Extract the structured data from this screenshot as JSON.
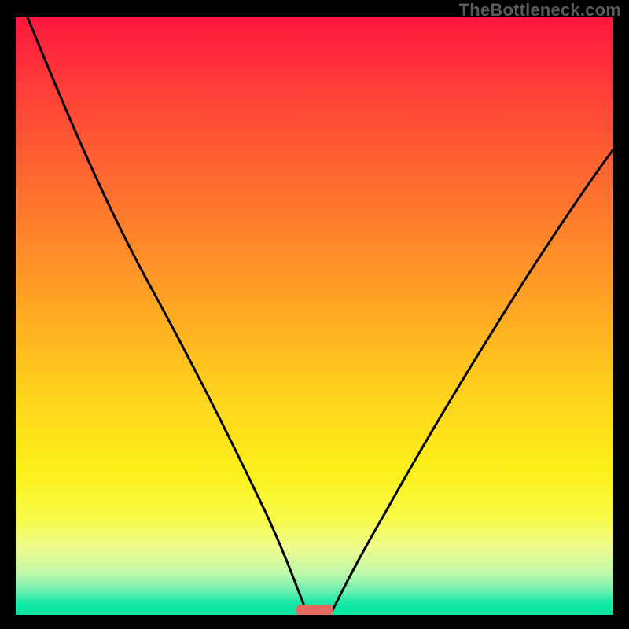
{
  "watermark": "TheBottleneck.com",
  "chart_data": {
    "type": "line",
    "title": "",
    "xlabel": "",
    "ylabel": "",
    "xlim": [
      0,
      100
    ],
    "ylim": [
      0,
      100
    ],
    "grid": false,
    "legend": false,
    "series": [
      {
        "name": "left-branch",
        "x": [
          2,
          7,
          13,
          20,
          27,
          33,
          38,
          42,
          45,
          47,
          48.5
        ],
        "values": [
          100,
          86,
          73,
          59,
          44,
          30,
          19,
          11,
          5,
          1.5,
          0.5
        ]
      },
      {
        "name": "right-branch",
        "x": [
          53,
          56,
          60,
          66,
          73,
          80,
          88,
          96,
          100
        ],
        "values": [
          0.5,
          2,
          6,
          14,
          25,
          37,
          51,
          65,
          72
        ]
      }
    ],
    "marker": {
      "x_start": 47,
      "x_end": 53,
      "y": 0.5
    },
    "background_gradient": {
      "top": "#ff173d",
      "bottom": "#00e79f",
      "stops": [
        "red",
        "orange",
        "yellow",
        "green"
      ]
    },
    "colors": {
      "curve": "#000000",
      "marker": "#e46a61",
      "frame": "#000000"
    }
  }
}
